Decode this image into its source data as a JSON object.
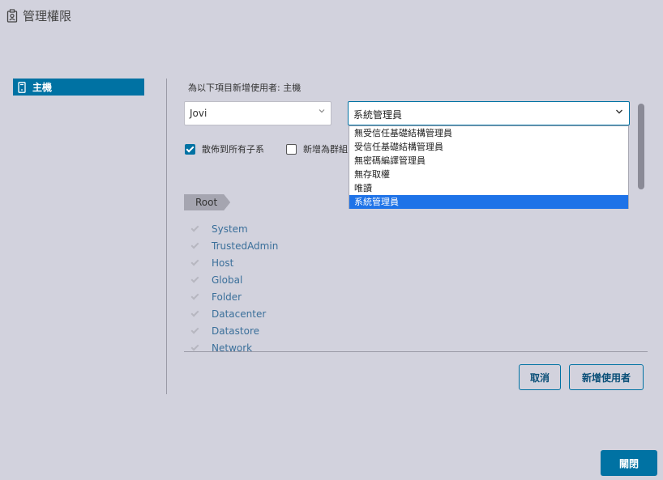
{
  "header": {
    "title": "管理權限",
    "icon": "badge-icon"
  },
  "sidebar": {
    "items": [
      {
        "label": "主機",
        "icon": "host-icon"
      }
    ]
  },
  "form": {
    "section_label": "為以下項目新增使用者: 主機",
    "user_select_value": "Jovi",
    "role_select_value": "系統管理員",
    "role_options": [
      "無受信任基礎結構管理員",
      "受信任基礎結構管理員",
      "無密碼編譯管理員",
      "無存取權",
      "唯讀",
      "系統管理員"
    ],
    "selected_option_index": 5,
    "propagate_label": "散佈到所有子系",
    "propagate_checked": true,
    "add_group_label": "新增為群組",
    "add_group_checked": false
  },
  "privileges": {
    "breadcrumb": "Root",
    "items": [
      "System",
      "TrustedAdmin",
      "Host",
      "Global",
      "Folder",
      "Datacenter",
      "Datastore",
      "Network"
    ]
  },
  "buttons": {
    "cancel": "取消",
    "add_user": "新增使用者",
    "close": "關閉"
  },
  "colors": {
    "accent": "#0072a3",
    "selected_option": "#1e73e8",
    "background": "#d2d2dd"
  }
}
